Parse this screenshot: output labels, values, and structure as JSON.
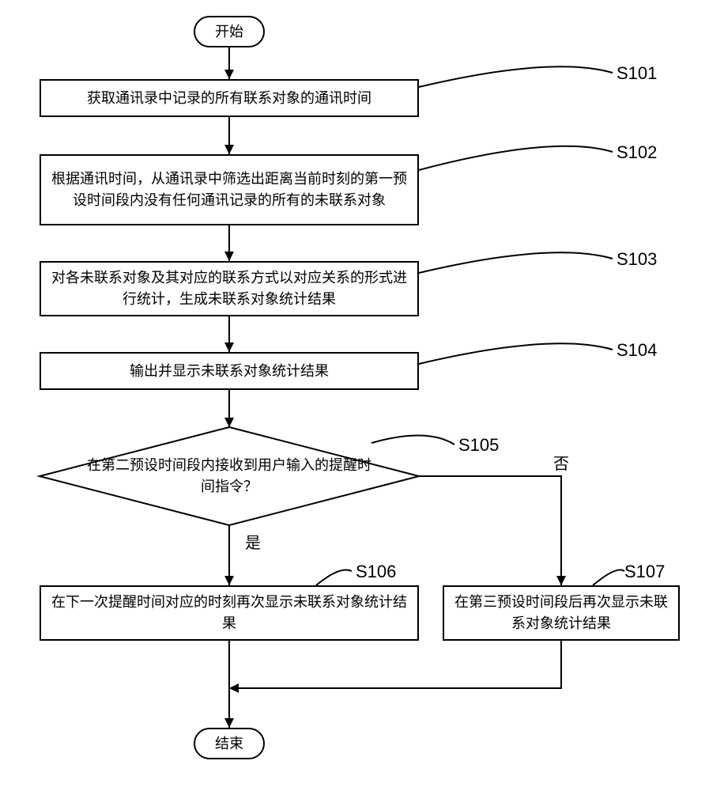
{
  "chart_data": {
    "type": "flowchart",
    "title": "",
    "nodes": [
      {
        "id": "start",
        "type": "terminator",
        "label": "开始"
      },
      {
        "id": "s101",
        "type": "process",
        "step": "S101",
        "label": "获取通讯录中记录的所有联系对象的通讯时间"
      },
      {
        "id": "s102",
        "type": "process",
        "step": "S102",
        "label": "根据通讯时间，从通讯录中筛选出距离当前时刻的第一预设时间段内没有任何通讯记录的所有的未联系对象"
      },
      {
        "id": "s103",
        "type": "process",
        "step": "S103",
        "label": "对各未联系对象及其对应的联系方式以对应关系的形式进行统计，生成未联系对象统计结果"
      },
      {
        "id": "s104",
        "type": "process",
        "step": "S104",
        "label": "输出并显示未联系对象统计结果"
      },
      {
        "id": "s105",
        "type": "decision",
        "step": "S105",
        "label": "在第二预设时间段内接收到用户输入的提醒时间指令？",
        "yes_label": "是",
        "no_label": "否"
      },
      {
        "id": "s106",
        "type": "process",
        "step": "S106",
        "label": "在下一次提醒时间对应的时刻再次显示未联系对象统计结果"
      },
      {
        "id": "s107",
        "type": "process",
        "step": "S107",
        "label": "在第三预设时间段后再次显示未联系对象统计结果"
      },
      {
        "id": "end",
        "type": "terminator",
        "label": "结束"
      }
    ],
    "edges": [
      {
        "from": "start",
        "to": "s101"
      },
      {
        "from": "s101",
        "to": "s102"
      },
      {
        "from": "s102",
        "to": "s103"
      },
      {
        "from": "s103",
        "to": "s104"
      },
      {
        "from": "s104",
        "to": "s105"
      },
      {
        "from": "s105",
        "to": "s106",
        "label": "是"
      },
      {
        "from": "s105",
        "to": "s107",
        "label": "否"
      },
      {
        "from": "s106",
        "to": "end"
      },
      {
        "from": "s107",
        "to": "end"
      }
    ]
  }
}
